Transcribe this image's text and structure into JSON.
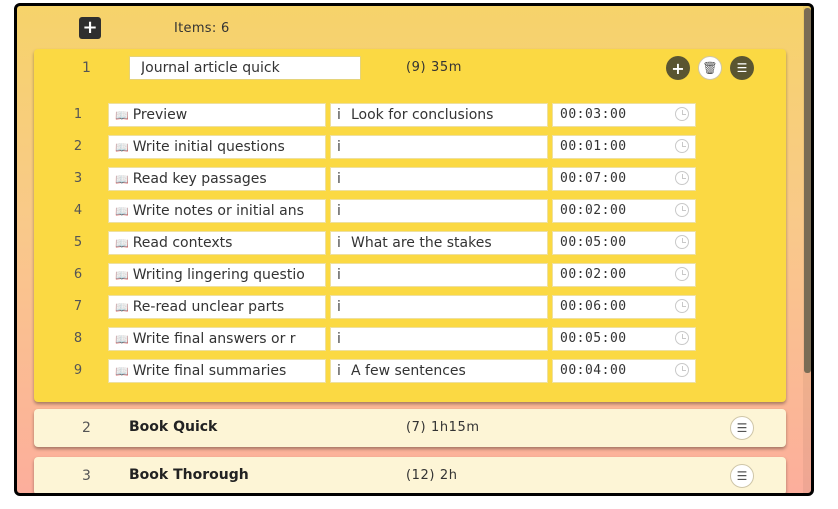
{
  "toolbar": {
    "add_icon": "plus-icon",
    "add_label": "+",
    "items_label": "Items: 6"
  },
  "colors": {
    "card_expanded": "#fbd943",
    "card_collapsed": "#fdf5d6",
    "dark_button": "#5a5531"
  },
  "routines": [
    {
      "number": "1",
      "title": "Journal article quick",
      "meta": "(9)  35m",
      "expanded": true,
      "actions": {
        "add_icon": "plus-circle-icon",
        "delete_icon": "trash-icon",
        "list_icon": "list-icon",
        "add_label": "+",
        "delete_label": "🗑",
        "list_label": "☰"
      },
      "steps": [
        {
          "number": "1",
          "icon": "book-icon",
          "name": "Preview",
          "note_icon": "info-icon",
          "note": "Look for conclusions",
          "time": "00:03:00",
          "clock_icon": "clock-icon"
        },
        {
          "number": "2",
          "icon": "book-icon",
          "name": "Write initial questions",
          "note_icon": "info-icon",
          "note": "",
          "time": "00:01:00",
          "clock_icon": "clock-icon"
        },
        {
          "number": "3",
          "icon": "book-icon",
          "name": "Read key passages",
          "note_icon": "info-icon",
          "note": "",
          "time": "00:07:00",
          "clock_icon": "clock-icon"
        },
        {
          "number": "4",
          "icon": "book-icon",
          "name": "Write notes or initial ans",
          "note_icon": "info-icon",
          "note": "",
          "time": "00:02:00",
          "clock_icon": "clock-icon"
        },
        {
          "number": "5",
          "icon": "book-icon",
          "name": "Read contexts",
          "note_icon": "info-icon",
          "note": "What are the stakes",
          "time": "00:05:00",
          "clock_icon": "clock-icon"
        },
        {
          "number": "6",
          "icon": "book-icon",
          "name": "Writing lingering questio",
          "note_icon": "info-icon",
          "note": "",
          "time": "00:02:00",
          "clock_icon": "clock-icon"
        },
        {
          "number": "7",
          "icon": "book-icon",
          "name": "Re-read unclear parts",
          "note_icon": "info-icon",
          "note": "",
          "time": "00:06:00",
          "clock_icon": "clock-icon"
        },
        {
          "number": "8",
          "icon": "book-icon",
          "name": "Write final answers or r",
          "note_icon": "info-icon",
          "note": "",
          "time": "00:05:00",
          "clock_icon": "clock-icon"
        },
        {
          "number": "9",
          "icon": "book-icon",
          "name": "Write final summaries",
          "note_icon": "info-icon",
          "note": "A few sentences",
          "time": "00:04:00",
          "clock_icon": "clock-icon"
        }
      ]
    },
    {
      "number": "2",
      "title": "Book Quick",
      "meta": "(7)  1h15m",
      "expanded": false,
      "list_icon": "list-icon",
      "list_label": "☰"
    },
    {
      "number": "3",
      "title": "Book Thorough",
      "meta": "(12)  2h",
      "expanded": false,
      "list_icon": "list-icon",
      "list_label": "☰"
    }
  ]
}
